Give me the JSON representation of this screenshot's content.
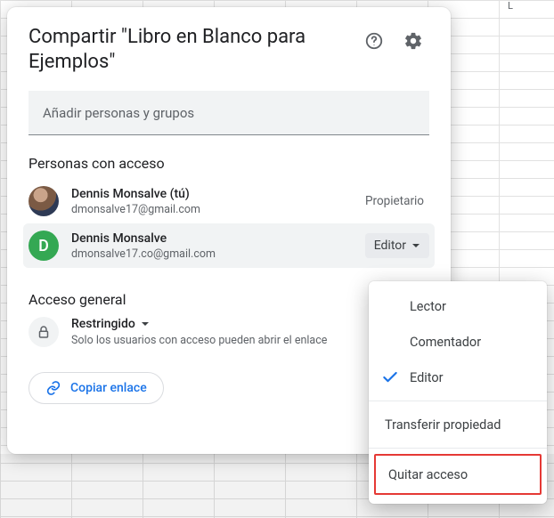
{
  "sheet": {
    "col_letter": "L"
  },
  "dialog": {
    "title": "Compartir \"Libro en Blanco para Ejemplos\"",
    "input_placeholder": "Añadir personas y grupos",
    "people_section": "Personas con acceso",
    "owner_label": "Propietario",
    "people": [
      {
        "name": "Dennis Monsalve (tú)",
        "email": "dmonsalve17@gmail.com",
        "initial": ""
      },
      {
        "name": "Dennis Monsalve",
        "email": "dmonsalve17.co@gmail.com",
        "initial": "D"
      }
    ],
    "role_chip": "Editor",
    "general_section": "Acceso general",
    "restricted_label": "Restringido",
    "restricted_desc": "Solo los usuarios con acceso pueden abrir el enlace",
    "copy_link": "Copiar enlace"
  },
  "menu": {
    "viewer": "Lector",
    "commenter": "Comentador",
    "editor": "Editor",
    "transfer": "Transferir propiedad",
    "remove": "Quitar acceso"
  }
}
